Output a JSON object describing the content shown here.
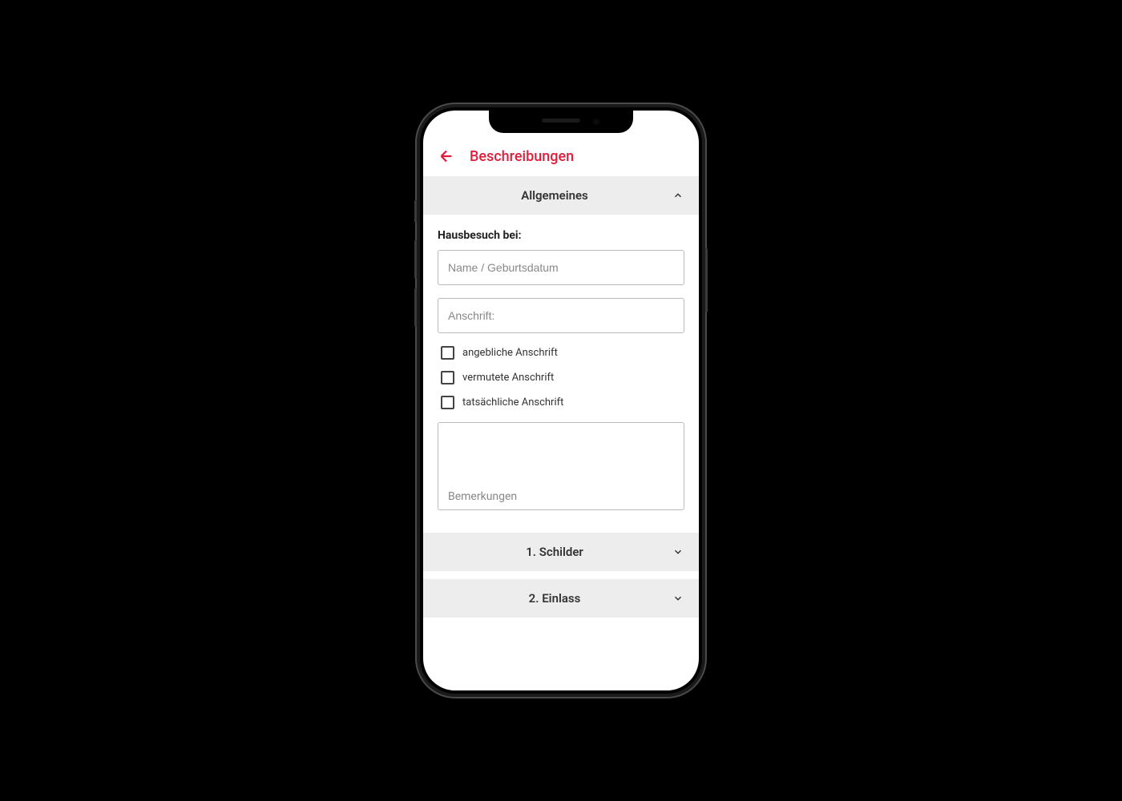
{
  "colors": {
    "accent": "#e01e3c"
  },
  "header": {
    "title": "Beschreibungen"
  },
  "sections": {
    "general": {
      "title": "Allgemeines",
      "expanded": true
    },
    "schilder": {
      "title": "1. Schilder",
      "expanded": false
    },
    "einlass": {
      "title": "2. Einlass",
      "expanded": false
    }
  },
  "form": {
    "visit_label": "Hausbesuch bei:",
    "name_placeholder": "Name / Geburtsdatum",
    "address_placeholder": "Anschrift:",
    "remarks_placeholder": "Bemerkungen",
    "checkboxes": {
      "alleged": "angebliche Anschrift",
      "suspected": "vermutete Anschrift",
      "actual": "tatsächliche Anschrift"
    }
  }
}
